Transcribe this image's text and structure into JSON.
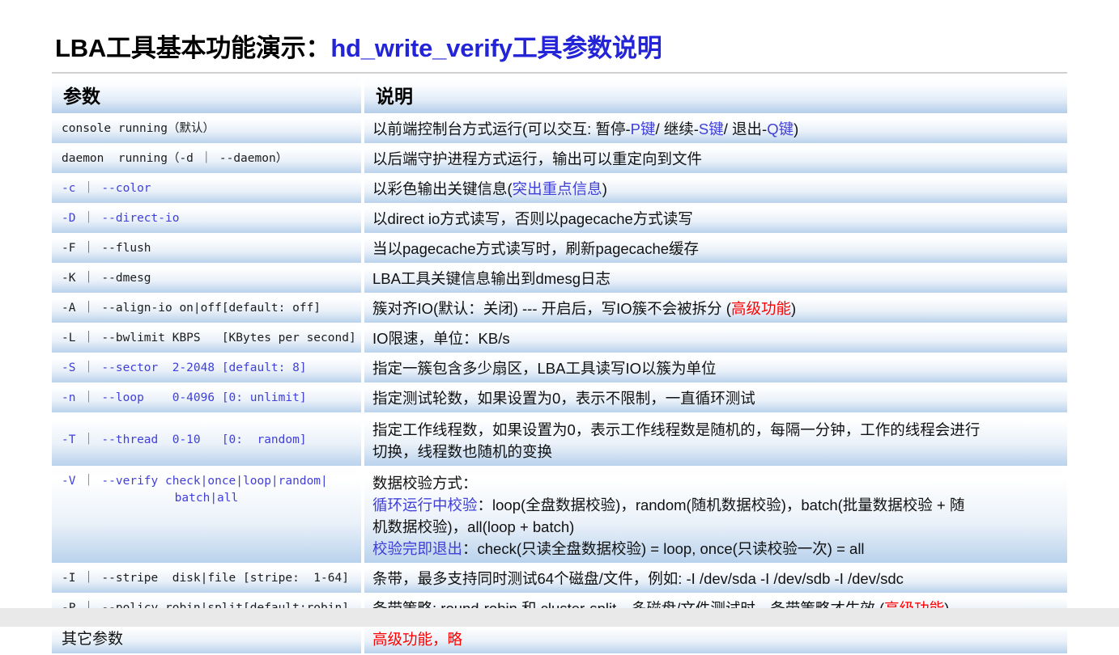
{
  "title": {
    "main": "LBA工具基本功能演示：",
    "accent": "hd_write_verify工具参数说明"
  },
  "colors": {
    "accent_blue": "#2323d8",
    "param_blue": "#4040d8",
    "warn_red": "#ff0000",
    "row_gradient_top": "#ffffff",
    "row_gradient_bottom": "#b9d2ec"
  },
  "table": {
    "headers": {
      "param": "参数",
      "desc": "说明"
    },
    "rows": [
      {
        "param": "console running（默认）",
        "param_color": "black",
        "desc_segments": [
          {
            "t": "以前端控制台方式运行(可以交互: 暂停-",
            "c": "black"
          },
          {
            "t": "P键",
            "c": "blue"
          },
          {
            "t": " / 继续-",
            "c": "black"
          },
          {
            "t": "S键",
            "c": "blue"
          },
          {
            "t": " / 退出-",
            "c": "black"
          },
          {
            "t": "Q键",
            "c": "blue"
          },
          {
            "t": ")",
            "c": "black"
          }
        ]
      },
      {
        "param": "daemon  running（-d ｜ --daemon）",
        "param_color": "black",
        "desc_segments": [
          {
            "t": "以后端守护进程方式运行，输出可以重定向到文件",
            "c": "black"
          }
        ]
      },
      {
        "param": "-c ｜ --color",
        "param_color": "blue",
        "desc_segments": [
          {
            "t": "以彩色输出关键信息(",
            "c": "black"
          },
          {
            "t": "突出重点信息",
            "c": "blue"
          },
          {
            "t": ")",
            "c": "black"
          }
        ]
      },
      {
        "param": "-D ｜ --direct-io",
        "param_color": "blue",
        "desc_segments": [
          {
            "t": "以direct io方式读写，否则以pagecache方式读写",
            "c": "black"
          }
        ]
      },
      {
        "param": "-F ｜ --flush",
        "param_color": "black",
        "desc_segments": [
          {
            "t": "当以pagecache方式读写时，刷新pagecache缓存",
            "c": "black"
          }
        ]
      },
      {
        "param": "-K ｜ --dmesg",
        "param_color": "black",
        "desc_segments": [
          {
            "t": "LBA工具关键信息输出到dmesg日志",
            "c": "black"
          }
        ]
      },
      {
        "param": "-A ｜ --align-io on|off[default: off]",
        "param_color": "black",
        "desc_segments": [
          {
            "t": "簇对齐IO(默认：关闭) --- 开启后，写IO簇不会被拆分 (",
            "c": "black"
          },
          {
            "t": "高级功能",
            "c": "red"
          },
          {
            "t": ")",
            "c": "black"
          }
        ]
      },
      {
        "param": "-L ｜ --bwlimit KBPS   [KBytes per second]",
        "param_color": "black",
        "desc_segments": [
          {
            "t": "IO限速，单位：KB/s",
            "c": "black"
          }
        ]
      },
      {
        "param": "-S ｜ --sector  2-2048 [default: 8]",
        "param_color": "blue",
        "desc_segments": [
          {
            "t": "指定一簇包含多少扇区，LBA工具读写IO以簇为单位",
            "c": "black"
          }
        ]
      },
      {
        "param": "-n ｜ --loop    0-4096 [0: unlimit]",
        "param_color": "blue",
        "desc_segments": [
          {
            "t": "指定测试轮数，如果设置为0，表示不限制，一直循环测试",
            "c": "black"
          }
        ]
      },
      {
        "param": "-T ｜ --thread  0-10   [0:  random]",
        "param_color": "blue",
        "desc_lines": [
          [
            {
              "t": "指定工作线程数，如果设置为0，表示工作线程数是随机的，每隔一分钟，工作的线程会进行",
              "c": "black"
            }
          ],
          [
            {
              "t": "切换，线程数也随机的变换",
              "c": "black"
            }
          ]
        ]
      },
      {
        "param_lines": [
          "-V ｜ --verify  check|once|loop|random|",
          "batch|all"
        ],
        "param_color": "blue",
        "desc_lines": [
          [
            {
              "t": "数据校验方式：",
              "c": "black"
            }
          ],
          [
            {
              "t": "循环运行中校验",
              "c": "blue"
            },
            {
              "t": "：loop(全盘数据校验)，random(随机数据校验)，batch(批量数据校验 + 随",
              "c": "black"
            }
          ],
          [
            {
              "t": "机数据校验)，all(loop + batch)",
              "c": "black"
            }
          ],
          [
            {
              "t": "校验完即退出",
              "c": "blue"
            },
            {
              "t": "：check(只读全盘数据校验) = loop, once(只读校验一次) = all",
              "c": "black"
            }
          ]
        ]
      },
      {
        "param": "-I ｜ --stripe  disk|file [stripe:  1-64]",
        "param_color": "black",
        "desc_segments": [
          {
            "t": "条带，最多支持同时测试64个磁盘/文件，例如: -I /dev/sda -I /dev/sdb -I /dev/sdc",
            "c": "black"
          }
        ]
      },
      {
        "param": "-P ｜ --policy robin|split[default:robin]",
        "param_color": "black",
        "desc_segments": [
          {
            "t": "条带策略: round-robin 和 cluster-split，多磁盘/文件测试时，条带策略才生效 (",
            "c": "black"
          },
          {
            "t": "高级功能",
            "c": "red"
          },
          {
            "t": ")",
            "c": "black"
          }
        ]
      },
      {
        "param": "其它参数",
        "param_color": "cjk",
        "desc_segments": [
          {
            "t": "高级功能，略",
            "c": "red"
          }
        ]
      }
    ]
  }
}
